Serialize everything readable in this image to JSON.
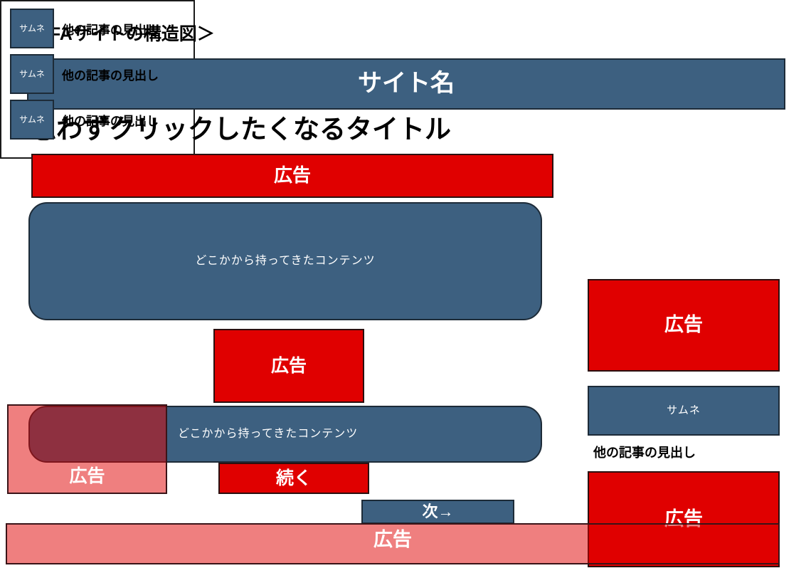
{
  "diagram": {
    "title": "＜MFAサイトの構造図＞"
  },
  "colors": {
    "blue": "#3D6080",
    "red": "#E00000",
    "red_translucent": "rgba(224,0,0,0.5)",
    "border_dark": "#1d2b38",
    "text_on_fill": "#FFFFFF",
    "text_body": "#000000",
    "page_background": "#FFFFFF"
  },
  "header": {
    "site_name": "サイト名"
  },
  "main": {
    "article_title": "思わずクリックしたくなるタイトル",
    "ad_top_label": "広告",
    "content_1": "どこかから持ってきたコンテンツ",
    "ad_mid_label": "広告",
    "content_2": "どこかから持ってきたコンテンツ",
    "ad_left_overlay_label": "広告",
    "continue_button": "続く",
    "next_button": "次→",
    "ad_bottom_bar_label": "広告"
  },
  "sidebar": {
    "related_items": [
      {
        "thumb": "サムネ",
        "label": "他の記事の見出し"
      },
      {
        "thumb": "サムネ",
        "label": "他の記事の見出し"
      },
      {
        "thumb": "サムネ",
        "label": "他の記事の見出し"
      }
    ],
    "ad_side_label": "広告",
    "thumb_wide": "サムネ",
    "related_caption": "他の記事の見出し",
    "ad_side_bottom_label": "広告"
  }
}
